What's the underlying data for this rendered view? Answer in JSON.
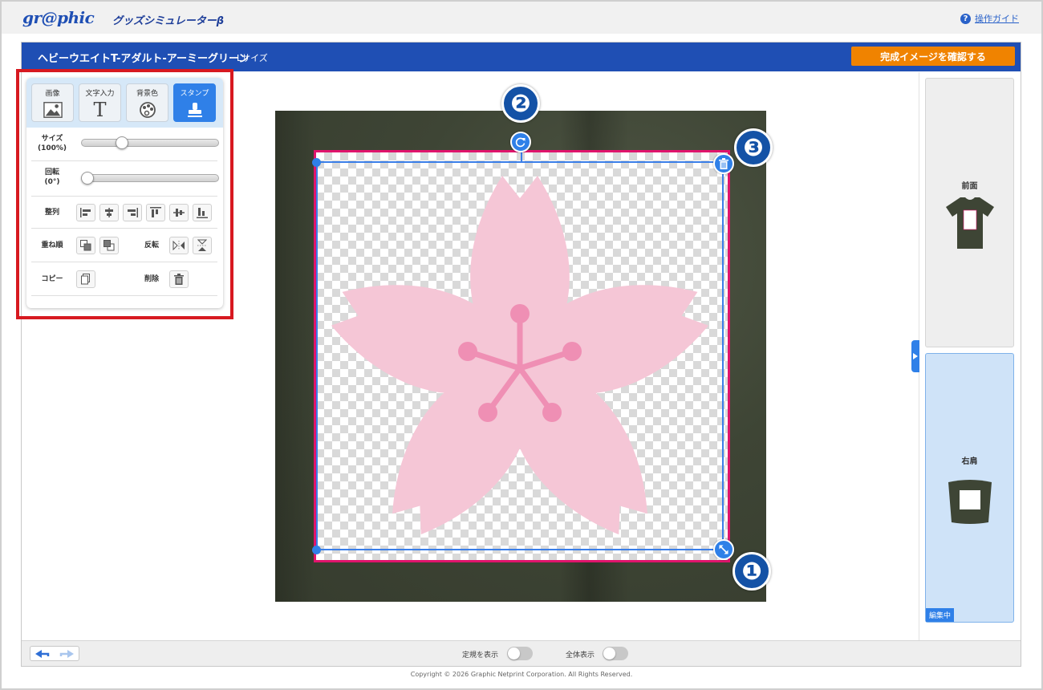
{
  "header": {
    "logo": "gr@phic",
    "subtitle": "グッズシミュレーターβ",
    "guide_label": "操作ガイド"
  },
  "titlebar": {
    "product_name": "ヘビーウエイトT-アダルト-アーミーグリーン",
    "size": "Lサイズ",
    "confirm_label": "完成イメージを確認する"
  },
  "tools": {
    "tabs": [
      {
        "label": "画像",
        "icon": "image-icon"
      },
      {
        "label": "文字入力",
        "icon": "text-icon"
      },
      {
        "label": "背景色",
        "icon": "palette-icon"
      },
      {
        "label": "スタンプ",
        "icon": "stamp-icon",
        "active": true
      }
    ],
    "size_label": "サイズ",
    "size_value": "(100%)",
    "size_level_percent": 28,
    "rotate_label": "回転",
    "rotate_value": "(0°)",
    "rotate_level_percent": 0,
    "align_label": "整列",
    "order_label": "重ね順",
    "flip_label": "反転",
    "copy_label": "コピー",
    "delete_label": "削除"
  },
  "callouts": {
    "one": "❶",
    "two": "❷",
    "three": "❸"
  },
  "views": {
    "front_label": "前面",
    "shoulder_label": "右肩",
    "editing_badge": "編集中"
  },
  "bottombar": {
    "ruler_label": "定規を表示",
    "fullview_label": "全体表示"
  },
  "footer": {
    "copyright": "Copyright © 2026 Graphic Netprint Corporation. All Rights Reserved."
  },
  "colors": {
    "brand_blue": "#1f4fb4",
    "accent_orange": "#f08300",
    "highlight_red": "#d71920",
    "selection_blue": "#3a7ee8",
    "frame_magenta": "#e0146c",
    "petal_pink": "#f5c6d6",
    "stamen_pink": "#ef8fb4",
    "shirt_green": "#3e4535"
  }
}
